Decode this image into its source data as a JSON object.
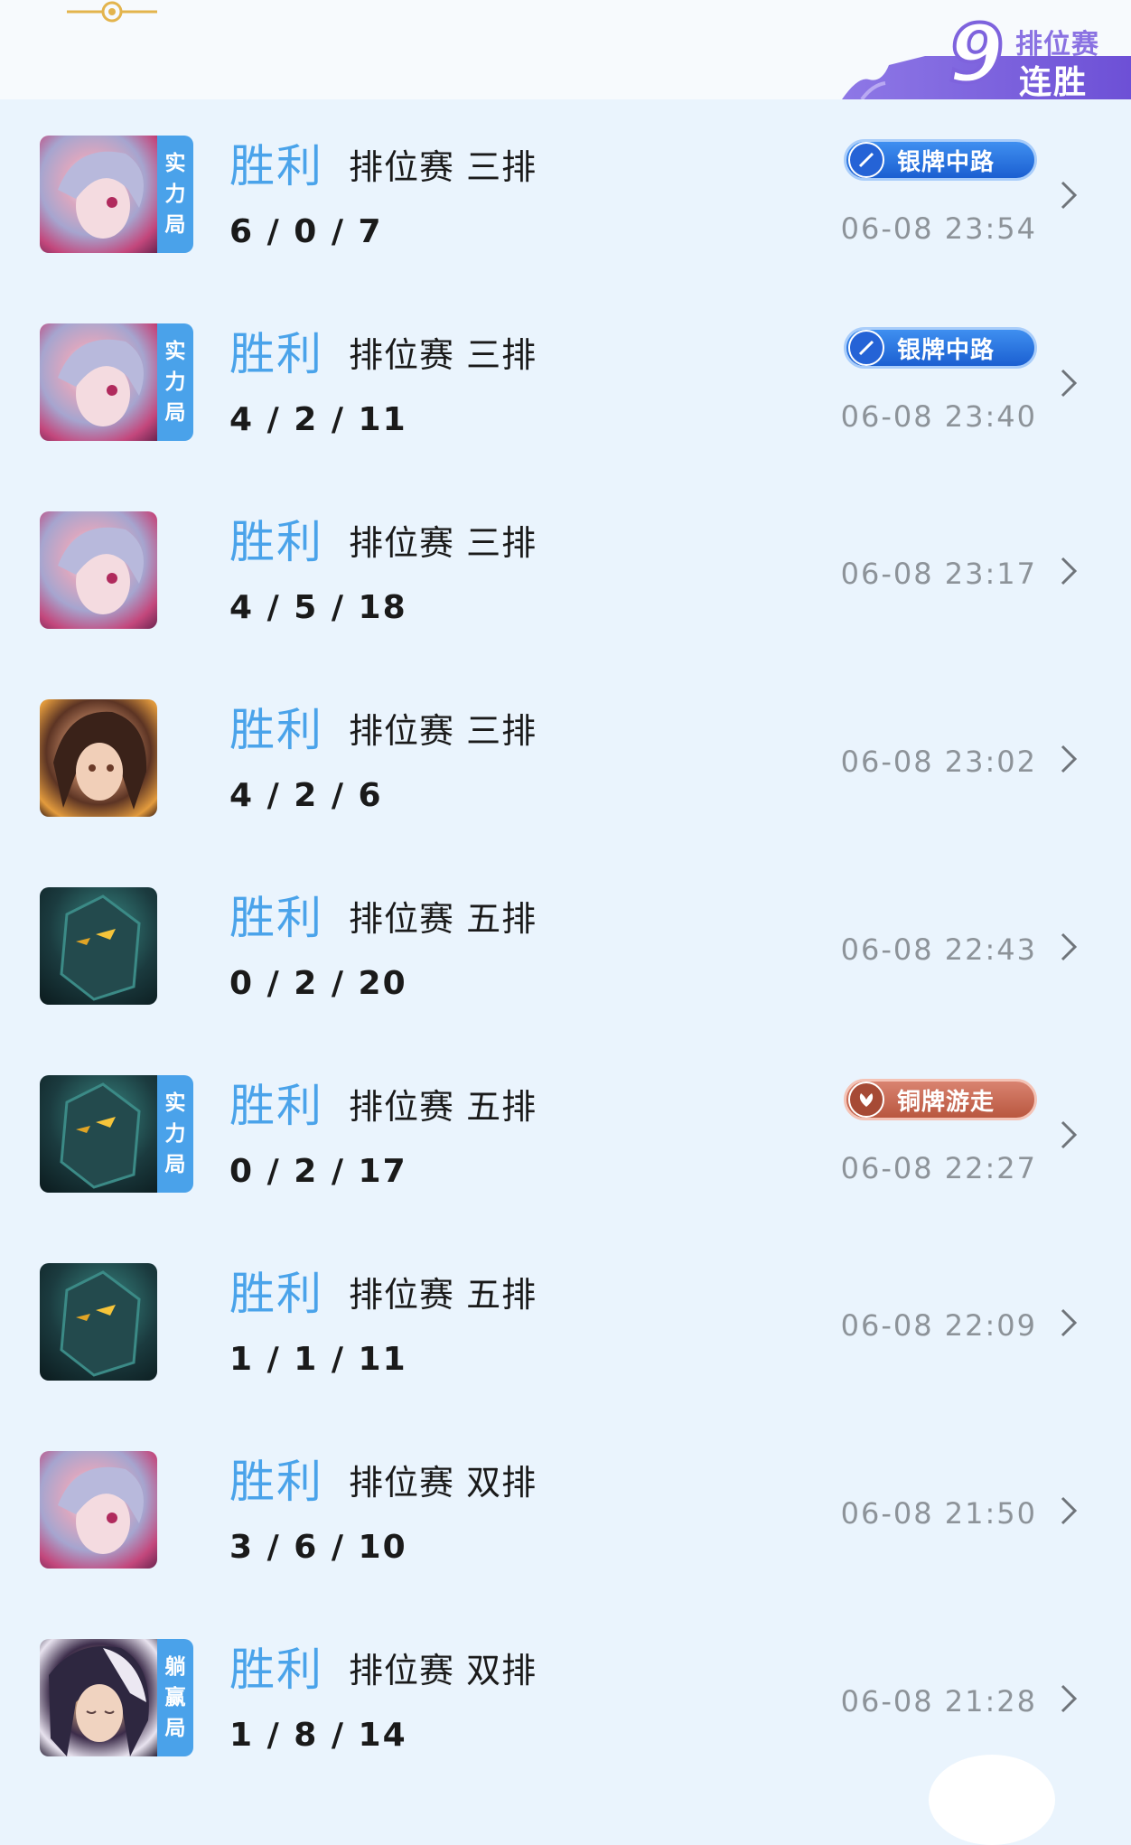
{
  "streak": {
    "count": "9",
    "line1": "排位赛",
    "line2": "连胜"
  },
  "matches": [
    {
      "result": "胜利",
      "mode": "排位赛 三排",
      "kda": "6 / 0 / 7",
      "time": "06-08 23:54",
      "tag": [
        "实",
        "力",
        "局"
      ],
      "badge": "银牌中路",
      "badge_type": "blue",
      "hero_icon": "hero-avatar-pink-hair"
    },
    {
      "result": "胜利",
      "mode": "排位赛 三排",
      "kda": "4 / 2 / 11",
      "time": "06-08 23:40",
      "tag": [
        "实",
        "力",
        "局"
      ],
      "badge": "银牌中路",
      "badge_type": "blue",
      "hero_icon": "hero-avatar-pink-hair"
    },
    {
      "result": "胜利",
      "mode": "排位赛 三排",
      "kda": "4 / 5 / 18",
      "time": "06-08 23:17",
      "tag": [],
      "badge": "",
      "hero_icon": "hero-avatar-pink-hair"
    },
    {
      "result": "胜利",
      "mode": "排位赛 三排",
      "kda": "4 / 2 / 6",
      "time": "06-08 23:02",
      "tag": [],
      "badge": "",
      "hero_icon": "hero-avatar-brown-hair"
    },
    {
      "result": "胜利",
      "mode": "排位赛 五排",
      "kda": "0 / 2 / 20",
      "time": "06-08 22:43",
      "tag": [],
      "badge": "",
      "hero_icon": "hero-avatar-armored"
    },
    {
      "result": "胜利",
      "mode": "排位赛 五排",
      "kda": "0 / 2 / 17",
      "time": "06-08 22:27",
      "tag": [
        "实",
        "力",
        "局"
      ],
      "badge": "铜牌游走",
      "badge_type": "bronze",
      "hero_icon": "hero-avatar-armored"
    },
    {
      "result": "胜利",
      "mode": "排位赛 五排",
      "kda": "1 / 1 / 11",
      "time": "06-08 22:09",
      "tag": [],
      "badge": "",
      "hero_icon": "hero-avatar-armored"
    },
    {
      "result": "胜利",
      "mode": "排位赛 双排",
      "kda": "3 / 6 / 10",
      "time": "06-08 21:50",
      "tag": [],
      "badge": "",
      "hero_icon": "hero-avatar-pink-hair"
    },
    {
      "result": "胜利",
      "mode": "排位赛 双排",
      "kda": "1 / 8 / 14",
      "time": "06-08 21:28",
      "tag": [
        "躺",
        "赢",
        "局"
      ],
      "badge": "",
      "hero_icon": "hero-avatar-white-hair"
    }
  ],
  "colors": {
    "win": "#4aa3ea",
    "tag_bg": "#4aa2ea",
    "silver_badge": "#1b5fd1",
    "bronze_badge": "#b9573f",
    "streak_purple": "#7e63dd"
  }
}
